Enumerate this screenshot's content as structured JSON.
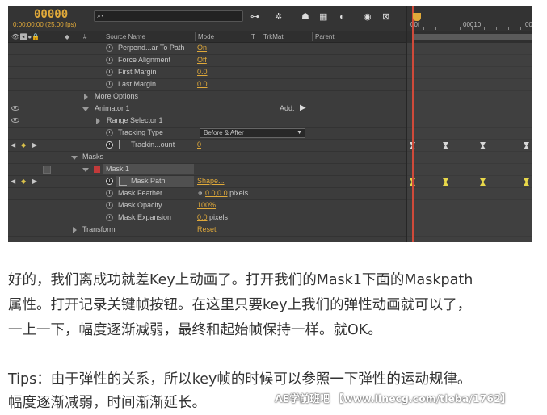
{
  "timeline": {
    "timecode": "00000",
    "timecode_sub": "0:00:00:00 (25.00 fps)",
    "search_placeholder": "⌕▾",
    "columns": {
      "source_name": "Source Name",
      "mode": "Mode",
      "t": "T",
      "trkmat": "TrkMat",
      "parent": "Parent",
      "hash": "#"
    },
    "ruler": {
      "start": "00f",
      "mid": "00010",
      "end": "00"
    },
    "rows": {
      "perpendicular": {
        "label": "Perpend...ar To Path",
        "value": "On"
      },
      "force_alignment": {
        "label": "Force Alignment",
        "value": "Off"
      },
      "first_margin": {
        "label": "First Margin",
        "value": "0.0"
      },
      "last_margin": {
        "label": "Last Margin",
        "value": "0.0"
      },
      "more_options": {
        "label": "More Options"
      },
      "animator": {
        "label": "Animator 1",
        "add_label": "Add:"
      },
      "range_selector": {
        "label": "Range Selector 1"
      },
      "tracking_type": {
        "label": "Tracking Type",
        "value": "Before & After"
      },
      "tracking_amount": {
        "label": "Trackin...ount",
        "value": "0"
      },
      "masks": {
        "label": "Masks"
      },
      "mask1": {
        "label": "Mask 1"
      },
      "mask_path": {
        "label": "Mask Path",
        "value": "Shape..."
      },
      "mask_feather": {
        "label": "Mask Feather",
        "value": "0.0,0.0",
        "unit": " pixels"
      },
      "mask_opacity": {
        "label": "Mask Opacity",
        "value": "100%"
      },
      "mask_expansion": {
        "label": "Mask Expansion",
        "value": "0.0",
        "unit": " pixels"
      },
      "transform": {
        "label": "Transform",
        "value": "Reset"
      }
    }
  },
  "article": {
    "line1": "好的，我们离成功就差Key上动画了。打开我们的Mask1下面的Maskpath",
    "line2": "属性。打开记录关键帧按钮。在这里只要key上我们的弹性动画就可以了，",
    "line3": "一上一下，幅度逐渐减弱，最终和起始帧保持一样。就OK。",
    "tips1": "Tips：由于弹性的关系，所以key帧的时候可以参照一下弹性的运动规律。",
    "tips2": "幅度逐渐减弱，时间渐渐延长。"
  },
  "watermark": "AE学前班吧 【www.linecg.com/tieba/1762】",
  "colors": {
    "panel_bg": "#3c3c3c",
    "value_orange": "#e0a93a",
    "keyframe_yellow": "#e8d84a",
    "cti_red": "#d04a3a",
    "mask_red": "#c23a3a"
  }
}
